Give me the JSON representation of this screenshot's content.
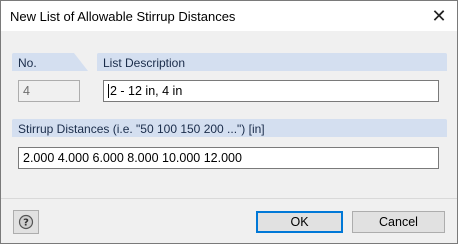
{
  "window": {
    "title": "New List of Allowable Stirrup Distances",
    "close_symbol": "✕"
  },
  "no_group": {
    "label": "No.",
    "value": "4"
  },
  "desc_group": {
    "label": "List Description",
    "value": "2 - 12 in, 4 in"
  },
  "dist_group": {
    "label": "Stirrup Distances (i.e. \"50 100 150 200 ...\") [in]",
    "value": "2.000 4.000 6.000 8.000 10.000 12.000"
  },
  "buttons": {
    "ok": "OK",
    "cancel": "Cancel",
    "help_icon": "help-icon"
  }
}
